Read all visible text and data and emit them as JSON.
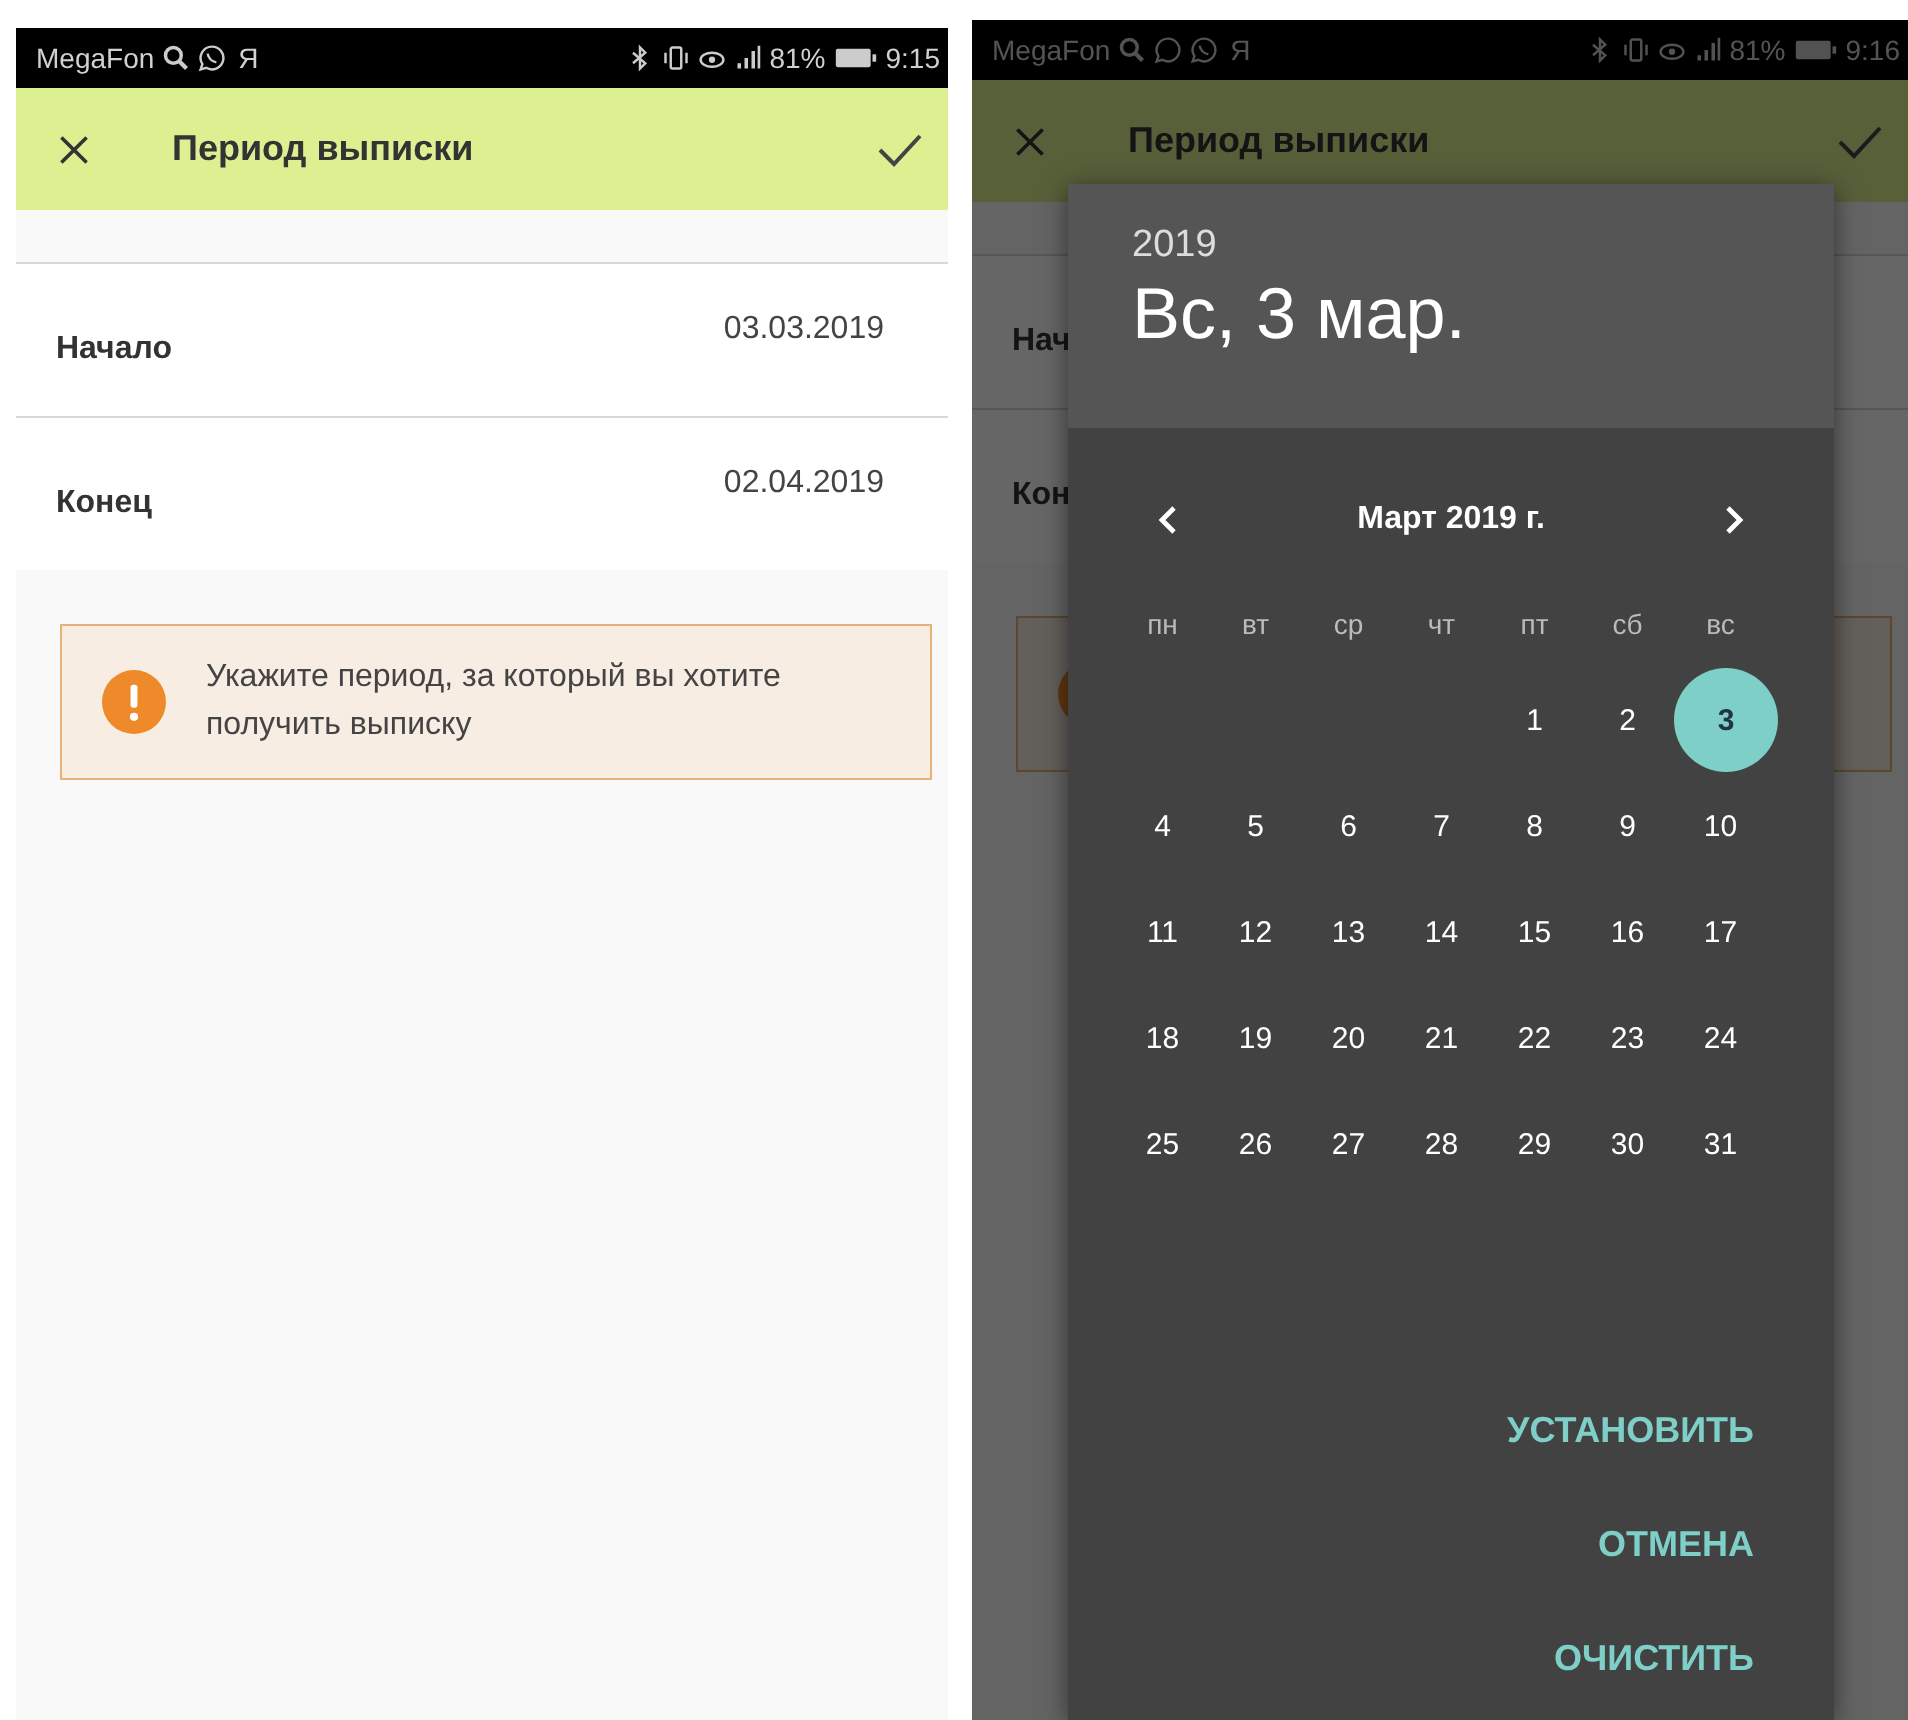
{
  "screens": [
    {
      "status_bar": {
        "carrier": "MegaFon",
        "letter": "Я",
        "battery": "81%",
        "time": "9:15"
      },
      "app_bar": {
        "title": "Период выписки"
      },
      "rows": [
        {
          "label": "Начало",
          "value": "03.03.2019"
        },
        {
          "label": "Конец",
          "value": "02.04.2019"
        }
      ],
      "alert": {
        "text": "Укажите период, за который вы хотите получить выписку"
      }
    },
    {
      "status_bar": {
        "carrier": "MegaFon",
        "letter": "Я",
        "battery": "81%",
        "time": "9:16"
      },
      "app_bar": {
        "title": "Период выписки"
      },
      "rows": [
        {
          "label": "Нач"
        },
        {
          "label": "Кон"
        }
      ],
      "date_picker": {
        "year": "2019",
        "date": "Вс, 3 мар.",
        "month": "Март 2019 г.",
        "weekdays": [
          "пн",
          "вт",
          "ср",
          "чт",
          "пт",
          "сб",
          "вс"
        ],
        "weeks": [
          [
            {
              "kind": "blank"
            },
            {
              "kind": "blank"
            },
            {
              "kind": "blank"
            },
            {
              "kind": "blank"
            },
            {
              "kind": "day",
              "day": "1",
              "selected": false
            },
            {
              "kind": "day",
              "day": "2",
              "selected": false
            },
            {
              "kind": "day",
              "day": "3",
              "selected": true
            }
          ],
          [
            {
              "kind": "day",
              "day": "4",
              "selected": false
            },
            {
              "kind": "day",
              "day": "5",
              "selected": false
            },
            {
              "kind": "day",
              "day": "6",
              "selected": false
            },
            {
              "kind": "day",
              "day": "7",
              "selected": false
            },
            {
              "kind": "day",
              "day": "8",
              "selected": false
            },
            {
              "kind": "day",
              "day": "9",
              "selected": false
            },
            {
              "kind": "day",
              "day": "10",
              "selected": false
            }
          ],
          [
            {
              "kind": "day",
              "day": "11",
              "selected": false
            },
            {
              "kind": "day",
              "day": "12",
              "selected": false
            },
            {
              "kind": "day",
              "day": "13",
              "selected": false
            },
            {
              "kind": "day",
              "day": "14",
              "selected": false
            },
            {
              "kind": "day",
              "day": "15",
              "selected": false
            },
            {
              "kind": "day",
              "day": "16",
              "selected": false
            },
            {
              "kind": "day",
              "day": "17",
              "selected": false
            }
          ],
          [
            {
              "kind": "day",
              "day": "18",
              "selected": false
            },
            {
              "kind": "day",
              "day": "19",
              "selected": false
            },
            {
              "kind": "day",
              "day": "20",
              "selected": false
            },
            {
              "kind": "day",
              "day": "21",
              "selected": false
            },
            {
              "kind": "day",
              "day": "22",
              "selected": false
            },
            {
              "kind": "day",
              "day": "23",
              "selected": false
            },
            {
              "kind": "day",
              "day": "24",
              "selected": false
            }
          ],
          [
            {
              "kind": "day",
              "day": "25",
              "selected": false
            },
            {
              "kind": "day",
              "day": "26",
              "selected": false
            },
            {
              "kind": "day",
              "day": "27",
              "selected": false
            },
            {
              "kind": "day",
              "day": "28",
              "selected": false
            },
            {
              "kind": "day",
              "day": "29",
              "selected": false
            },
            {
              "kind": "day",
              "day": "30",
              "selected": false
            },
            {
              "kind": "day",
              "day": "31",
              "selected": false
            }
          ]
        ],
        "buttons": [
          "УСТАНОВИТЬ",
          "ОТМЕНА",
          "ОЧИСТИТЬ"
        ]
      }
    }
  ]
}
